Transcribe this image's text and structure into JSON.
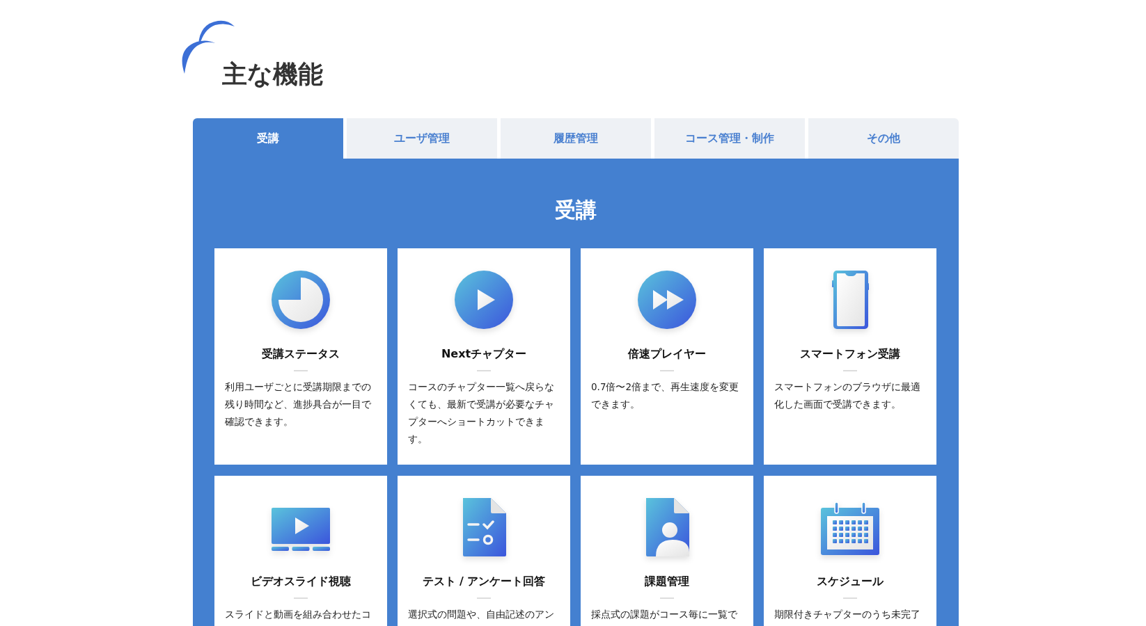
{
  "page_title": "主な機能",
  "tabs": [
    {
      "label": "受講",
      "selected": true
    },
    {
      "label": "ユーザ管理",
      "selected": false
    },
    {
      "label": "履歴管理",
      "selected": false
    },
    {
      "label": "コース管理・制作",
      "selected": false
    },
    {
      "label": "その他",
      "selected": false
    }
  ],
  "section_title": "受講",
  "features": [
    {
      "kind": "clock",
      "title": "受講ステータス",
      "description": "利用ユーザごとに受講期限までの残り時間など、進捗具合が一目で確認できます。"
    },
    {
      "kind": "play",
      "title": "Nextチャプター",
      "description": "コースのチャプター一覧へ戻らなくても、最新で受講が必要なチャプターへショートカットできます。"
    },
    {
      "kind": "fast-forward",
      "title": "倍速プレイヤー",
      "description": "0.7倍〜2倍まで、再生速度を変更できます。"
    },
    {
      "kind": "phone",
      "title": "スマートフォン受講",
      "description": "スマートフォンのブラウザに最適化した画面で受講できます。"
    },
    {
      "kind": "video",
      "title": "ビデオスライド視聴",
      "description": "スライドと動画を組み合わせたコ"
    },
    {
      "kind": "quiz",
      "title": "テスト / アンケート回答",
      "description": "選択式の問題や、自由記述のアン"
    },
    {
      "kind": "assignment",
      "title": "課題管理",
      "description": "採点式の課題がコース毎に一覧で"
    },
    {
      "kind": "calendar",
      "title": "スケジュール",
      "description": "期限付きチャプターのうち未完了"
    }
  ]
}
